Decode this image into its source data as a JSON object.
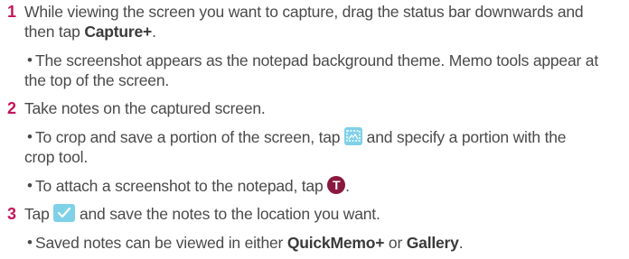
{
  "steps": [
    {
      "number": "1",
      "line1": "While viewing the screen you want to capture, drag the status bar downwards and",
      "line2_prefix": "then tap ",
      "line2_bold": "Capture+",
      "line2_suffix": ".",
      "bullets": [
        {
          "line1": "The screenshot appears as the notepad background theme. Memo tools appear at",
          "line2": "the top of the screen."
        }
      ]
    },
    {
      "number": "2",
      "line1": "Take notes on the captured screen.",
      "bullets": [
        {
          "line1_prefix": "To crop and save a portion of the screen, tap ",
          "icon": "crop-image-icon",
          "line1_suffix": " and specify a portion with the",
          "line2": "crop tool."
        },
        {
          "line1_prefix": "To attach a screenshot to the notepad, tap ",
          "icon": "text-t-icon",
          "icon_glyph": "T",
          "line1_suffix": "."
        }
      ]
    },
    {
      "number": "3",
      "line1_prefix": "Tap ",
      "icon": "checkmark-icon",
      "line1_suffix": " and save the notes to the location you want.",
      "bullets": [
        {
          "prefix": "Saved notes can be viewed in either ",
          "bold1": "QuickMemo+",
          "middle": " or ",
          "bold2": "Gallery",
          "suffix": "."
        }
      ]
    }
  ],
  "bullet_glyph": "•",
  "colors": {
    "step_number": "#c4145a",
    "icon_light": "#7fd1e8",
    "icon_dark": "#8a1840",
    "text": "#4a4a4a"
  }
}
